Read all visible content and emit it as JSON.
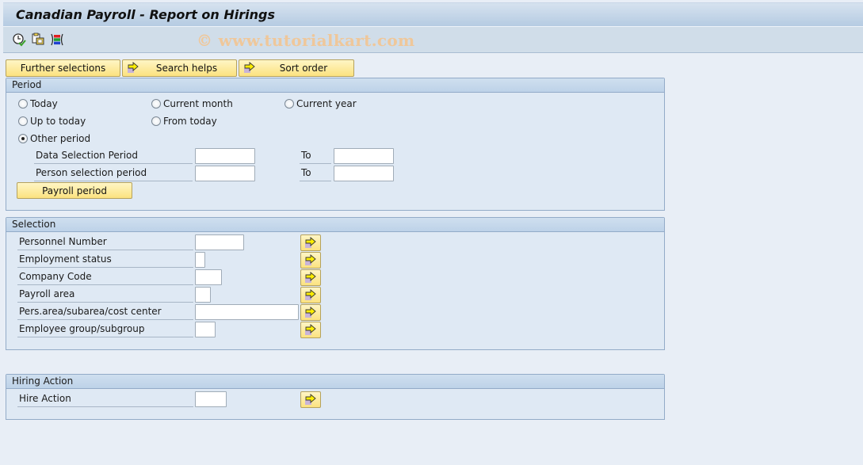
{
  "window": {
    "title": "Canadian Payroll - Report on Hirings"
  },
  "toolbar": {
    "icons": [
      "execute-clock-icon",
      "get-variant-icon",
      "selection-options-icon"
    ],
    "watermark": "© www.tutorialkart.com"
  },
  "tabs": {
    "further_selections": "Further selections",
    "search_helps": "Search helps",
    "sort_order": "Sort order"
  },
  "period": {
    "header": "Period",
    "radios": [
      {
        "label": "Today",
        "checked": false
      },
      {
        "label": "Current month",
        "checked": false
      },
      {
        "label": "Current year",
        "checked": false
      },
      {
        "label": "Up to today",
        "checked": false
      },
      {
        "label": "From today",
        "checked": false
      },
      {
        "label": "Other period",
        "checked": true
      }
    ],
    "data_selection": {
      "label": "Data Selection Period",
      "from": "",
      "to_label": "To",
      "to": ""
    },
    "person_selection": {
      "label": "Person selection period",
      "from": "",
      "to_label": "To",
      "to": ""
    },
    "payroll_period_button": "Payroll period"
  },
  "selection": {
    "header": "Selection",
    "fields": [
      {
        "label": "Personnel Number",
        "value": ""
      },
      {
        "label": "Employment status",
        "value": ""
      },
      {
        "label": "Company Code",
        "value": ""
      },
      {
        "label": "Payroll area",
        "value": ""
      },
      {
        "label": "Pers.area/subarea/cost center",
        "value": ""
      },
      {
        "label": "Employee group/subgroup",
        "value": ""
      }
    ]
  },
  "hiring_action": {
    "header": "Hiring Action",
    "fields": [
      {
        "label": "Hire Action",
        "value": ""
      }
    ]
  }
}
